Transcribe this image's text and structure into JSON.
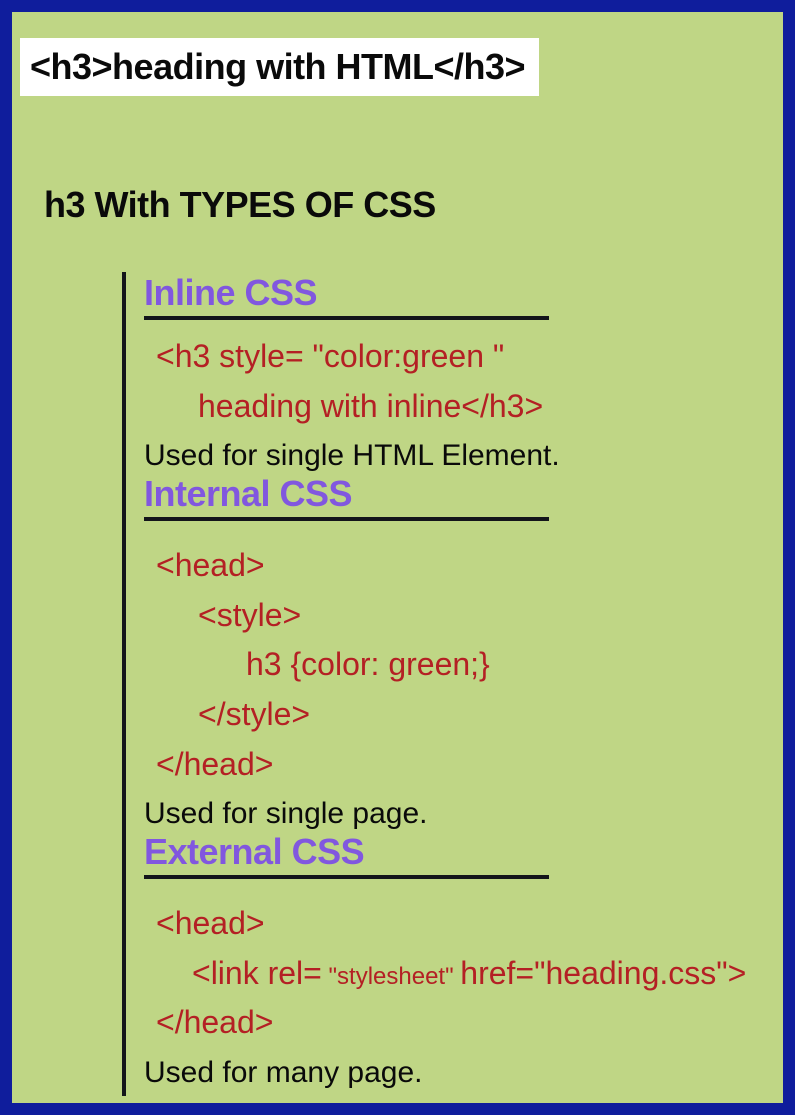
{
  "title": "<h3>heading with HTML</h3>",
  "subtitle": "h3 With TYPES OF CSS",
  "sections": {
    "inline": {
      "header": "Inline CSS",
      "code_line1": "<h3 style= \"color:green \"",
      "code_line2": "heading with inline</h3>",
      "desc": "Used for single HTML Element."
    },
    "internal": {
      "header": "Internal CSS",
      "code_line1": "<head>",
      "code_line2": "<style>",
      "code_line3": "h3   {color: green;}",
      "code_line4": "</style>",
      "code_line5": "</head>",
      "desc": "Used for single page."
    },
    "external": {
      "header": "External CSS",
      "code_line1": "<head>",
      "code_line2a": "<link rel=",
      "code_line2b": " \"stylesheet\"  ",
      "code_line2c": "href=\"heading.css\">",
      "code_line3": "</head>",
      "desc": "Used for many page."
    }
  }
}
